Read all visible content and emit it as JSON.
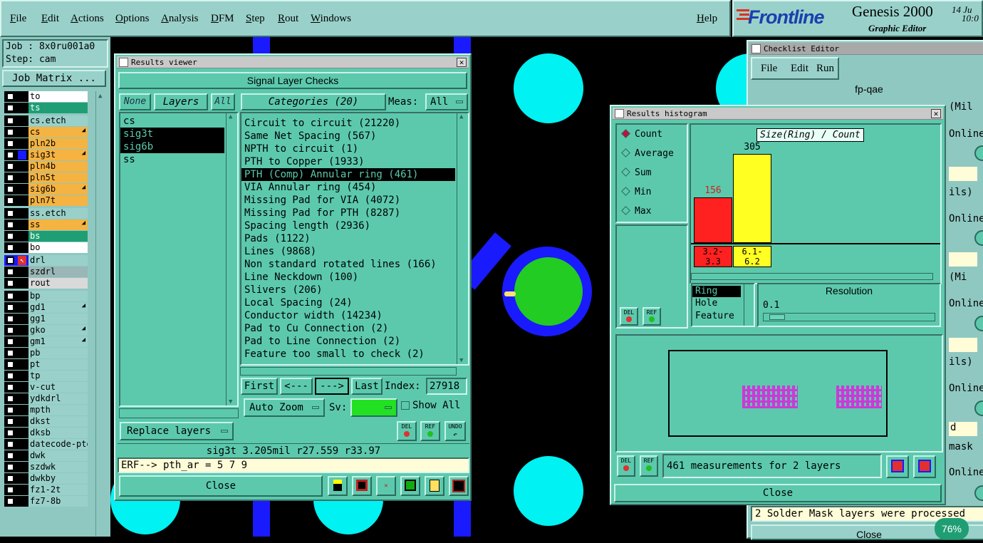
{
  "menubar": {
    "items": [
      "File",
      "Edit",
      "Actions",
      "Options",
      "Analysis",
      "DFM",
      "Step",
      "Rout",
      "Windows"
    ],
    "help": "Help"
  },
  "brand": {
    "logo": "Frontline",
    "product": "Genesis 2000",
    "subtitle": "Graphic Editor",
    "date": "14 Ju",
    "time": "10:0"
  },
  "left": {
    "job": "Job : 8x0ru001a0",
    "step": "Step: cam",
    "job_matrix": "Job Matrix ...",
    "layers": [
      {
        "name": "to",
        "color": "#ffffff"
      },
      {
        "name": "ts",
        "color": "#1f9e73"
      },
      {
        "name": "cs.etch",
        "color": "#99d1ca"
      },
      {
        "name": "cs",
        "color": "#f5b342"
      },
      {
        "name": "pln2b",
        "color": "#f5b342"
      },
      {
        "name": "sig3t",
        "color": "#f5b342"
      },
      {
        "name": "pln4b",
        "color": "#f5b342"
      },
      {
        "name": "pln5t",
        "color": "#f5b342"
      },
      {
        "name": "sig6b",
        "color": "#f5b342"
      },
      {
        "name": "pln7t",
        "color": "#f5b342"
      },
      {
        "name": "ss.etch",
        "color": "#99d1ca"
      },
      {
        "name": "ss",
        "color": "#f5b342"
      },
      {
        "name": "bs",
        "color": "#1f9e73"
      },
      {
        "name": "bo",
        "color": "#ffffff"
      },
      {
        "name": "drl",
        "color": "#99d1ca"
      },
      {
        "name": "szdrl",
        "color": "#9ab6b6"
      },
      {
        "name": "rout",
        "color": "#d9d9d9"
      },
      {
        "name": "bp",
        "color": "#99d1ca"
      },
      {
        "name": "gd1",
        "color": "#99d1ca"
      },
      {
        "name": "gg1",
        "color": "#99d1ca"
      },
      {
        "name": "gko",
        "color": "#99d1ca"
      },
      {
        "name": "gm1",
        "color": "#99d1ca"
      },
      {
        "name": "pb",
        "color": "#99d1ca"
      },
      {
        "name": "pt",
        "color": "#99d1ca"
      },
      {
        "name": "tp",
        "color": "#99d1ca"
      },
      {
        "name": "v-cut",
        "color": "#99d1ca"
      },
      {
        "name": "ydkdrl",
        "color": "#99d1ca"
      },
      {
        "name": "mpth",
        "color": "#99d1ca"
      },
      {
        "name": "dkst",
        "color": "#99d1ca"
      },
      {
        "name": "dksb",
        "color": "#99d1ca"
      },
      {
        "name": "datecode-pte",
        "color": "#99d1ca"
      },
      {
        "name": "dwk",
        "color": "#99d1ca"
      },
      {
        "name": "szdwk",
        "color": "#99d1ca"
      },
      {
        "name": "dwkby",
        "color": "#99d1ca"
      },
      {
        "name": "fz1-2t",
        "color": "#99d1ca"
      },
      {
        "name": "fz7-8b",
        "color": "#99d1ca"
      }
    ]
  },
  "results_viewer": {
    "title": "Results viewer",
    "header": "Signal Layer Checks",
    "none": "None",
    "layers_tab": "Layers",
    "all_tab": "All",
    "categories": "Categories (20)",
    "meas_label": "Meas:",
    "meas_value": "All",
    "layer_list": [
      "cs",
      "sig3t",
      "sig6b",
      "ss"
    ],
    "category_list": [
      "Circuit to circuit (21220)",
      "Same Net Spacing (567)",
      "NPTH to circuit (1)",
      "PTH to Copper (1933)",
      "PTH (Comp) Annular ring (461)",
      "VIA Annular ring (454)",
      "Missing Pad for VIA (4072)",
      "Missing Pad for PTH (8287)",
      "Spacing length (2936)",
      "Pads (1122)",
      "Lines (9868)",
      "Non standard rotated lines (166)",
      "Line Neckdown (100)",
      "Slivers (206)",
      "Local Spacing (24)",
      "Conductor width (14234)",
      "Pad to Cu Connection (2)",
      "Pad to Line Connection (2)",
      "Feature too small to check (2)"
    ],
    "first": "First",
    "prev": "<---",
    "next": "--->",
    "last": "Last",
    "index_label": "Index:",
    "index_value": "27918",
    "auto_zoom": "Auto Zoom",
    "sv_label": "Sv:",
    "show_all": "Show All",
    "replace_layers": "Replace layers",
    "del": "DEL",
    "ref": "REF",
    "undo": "UNDO",
    "status": "sig3t 3.205mil  r27.559  r33.97",
    "erf": "ERF--> pth_ar = 5 7 9",
    "close": "Close"
  },
  "checklist": {
    "title": "Checklist Editor",
    "menu": [
      "File",
      "Edit",
      "Run"
    ],
    "name": "fp-qae",
    "fragments": [
      "(Mil",
      "Online.",
      "ils)",
      "Online.",
      "(Mi",
      "Online.",
      "ils)",
      "Online.",
      "d",
      "mask",
      "Online."
    ],
    "message": "2 Solder Mask layers were processed",
    "close": "Close"
  },
  "histogram": {
    "title": "Results histogram",
    "modes": [
      "Count",
      "Average",
      "Sum",
      "Min",
      "Max"
    ],
    "selected_mode": "Count",
    "chart_title": "Size(Ring) / Count",
    "bars": [
      {
        "value": 156,
        "label_top": "3.2-",
        "label_bot": "3.3",
        "color": "#ff2020"
      },
      {
        "value": 305,
        "label_top": "6.1-",
        "label_bot": "6.2",
        "color": "#ffff22"
      }
    ],
    "fields": [
      "Ring",
      "Hole",
      "Feature"
    ],
    "resolution_label": "Resolution",
    "resolution_value": "0.1",
    "del": "DEL",
    "ref": "REF",
    "summary": "461 measurements for 2 layers",
    "close": "Close"
  },
  "zoom": "76%"
}
